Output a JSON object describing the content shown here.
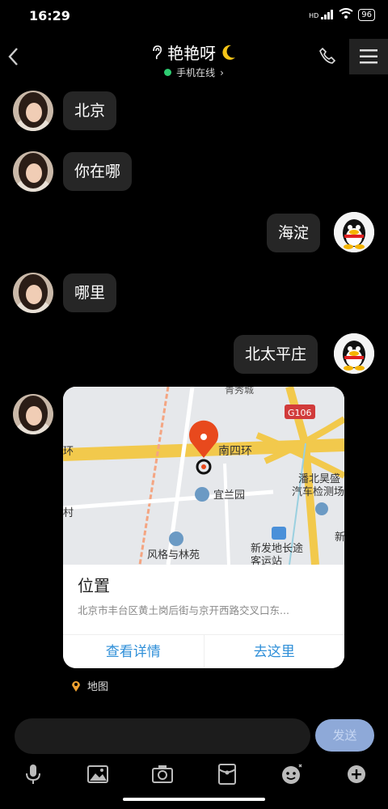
{
  "status_bar": {
    "time": "16:29",
    "signal": "HD",
    "battery": "96"
  },
  "header": {
    "title": "艳艳呀",
    "presence": "手机在线"
  },
  "messages": [
    {
      "side": "left",
      "text": "北京"
    },
    {
      "side": "left",
      "text": "你在哪"
    },
    {
      "side": "right",
      "text": "海淀"
    },
    {
      "side": "left",
      "text": "哪里"
    },
    {
      "side": "right",
      "text": "北太平庄"
    }
  ],
  "location_card": {
    "map_labels": [
      "青秀城",
      "G106",
      "南四环",
      "宜兰园",
      "潘北昊盛",
      "汽车检测场",
      "环",
      "村",
      "风格与林苑",
      "新发地长途",
      "客运站",
      "新"
    ],
    "title": "位置",
    "address": "北京市丰台区黄土岗后街与京开西路交叉口东...",
    "actions": [
      "查看详情",
      "去这里"
    ],
    "source_label": "地图"
  },
  "input": {
    "send_label": "发送"
  },
  "colors": {
    "online": "#2ecc71",
    "action_blue": "#2f8fd8",
    "pin_red": "#e8491d",
    "send_bg": "#8ea9d8"
  }
}
